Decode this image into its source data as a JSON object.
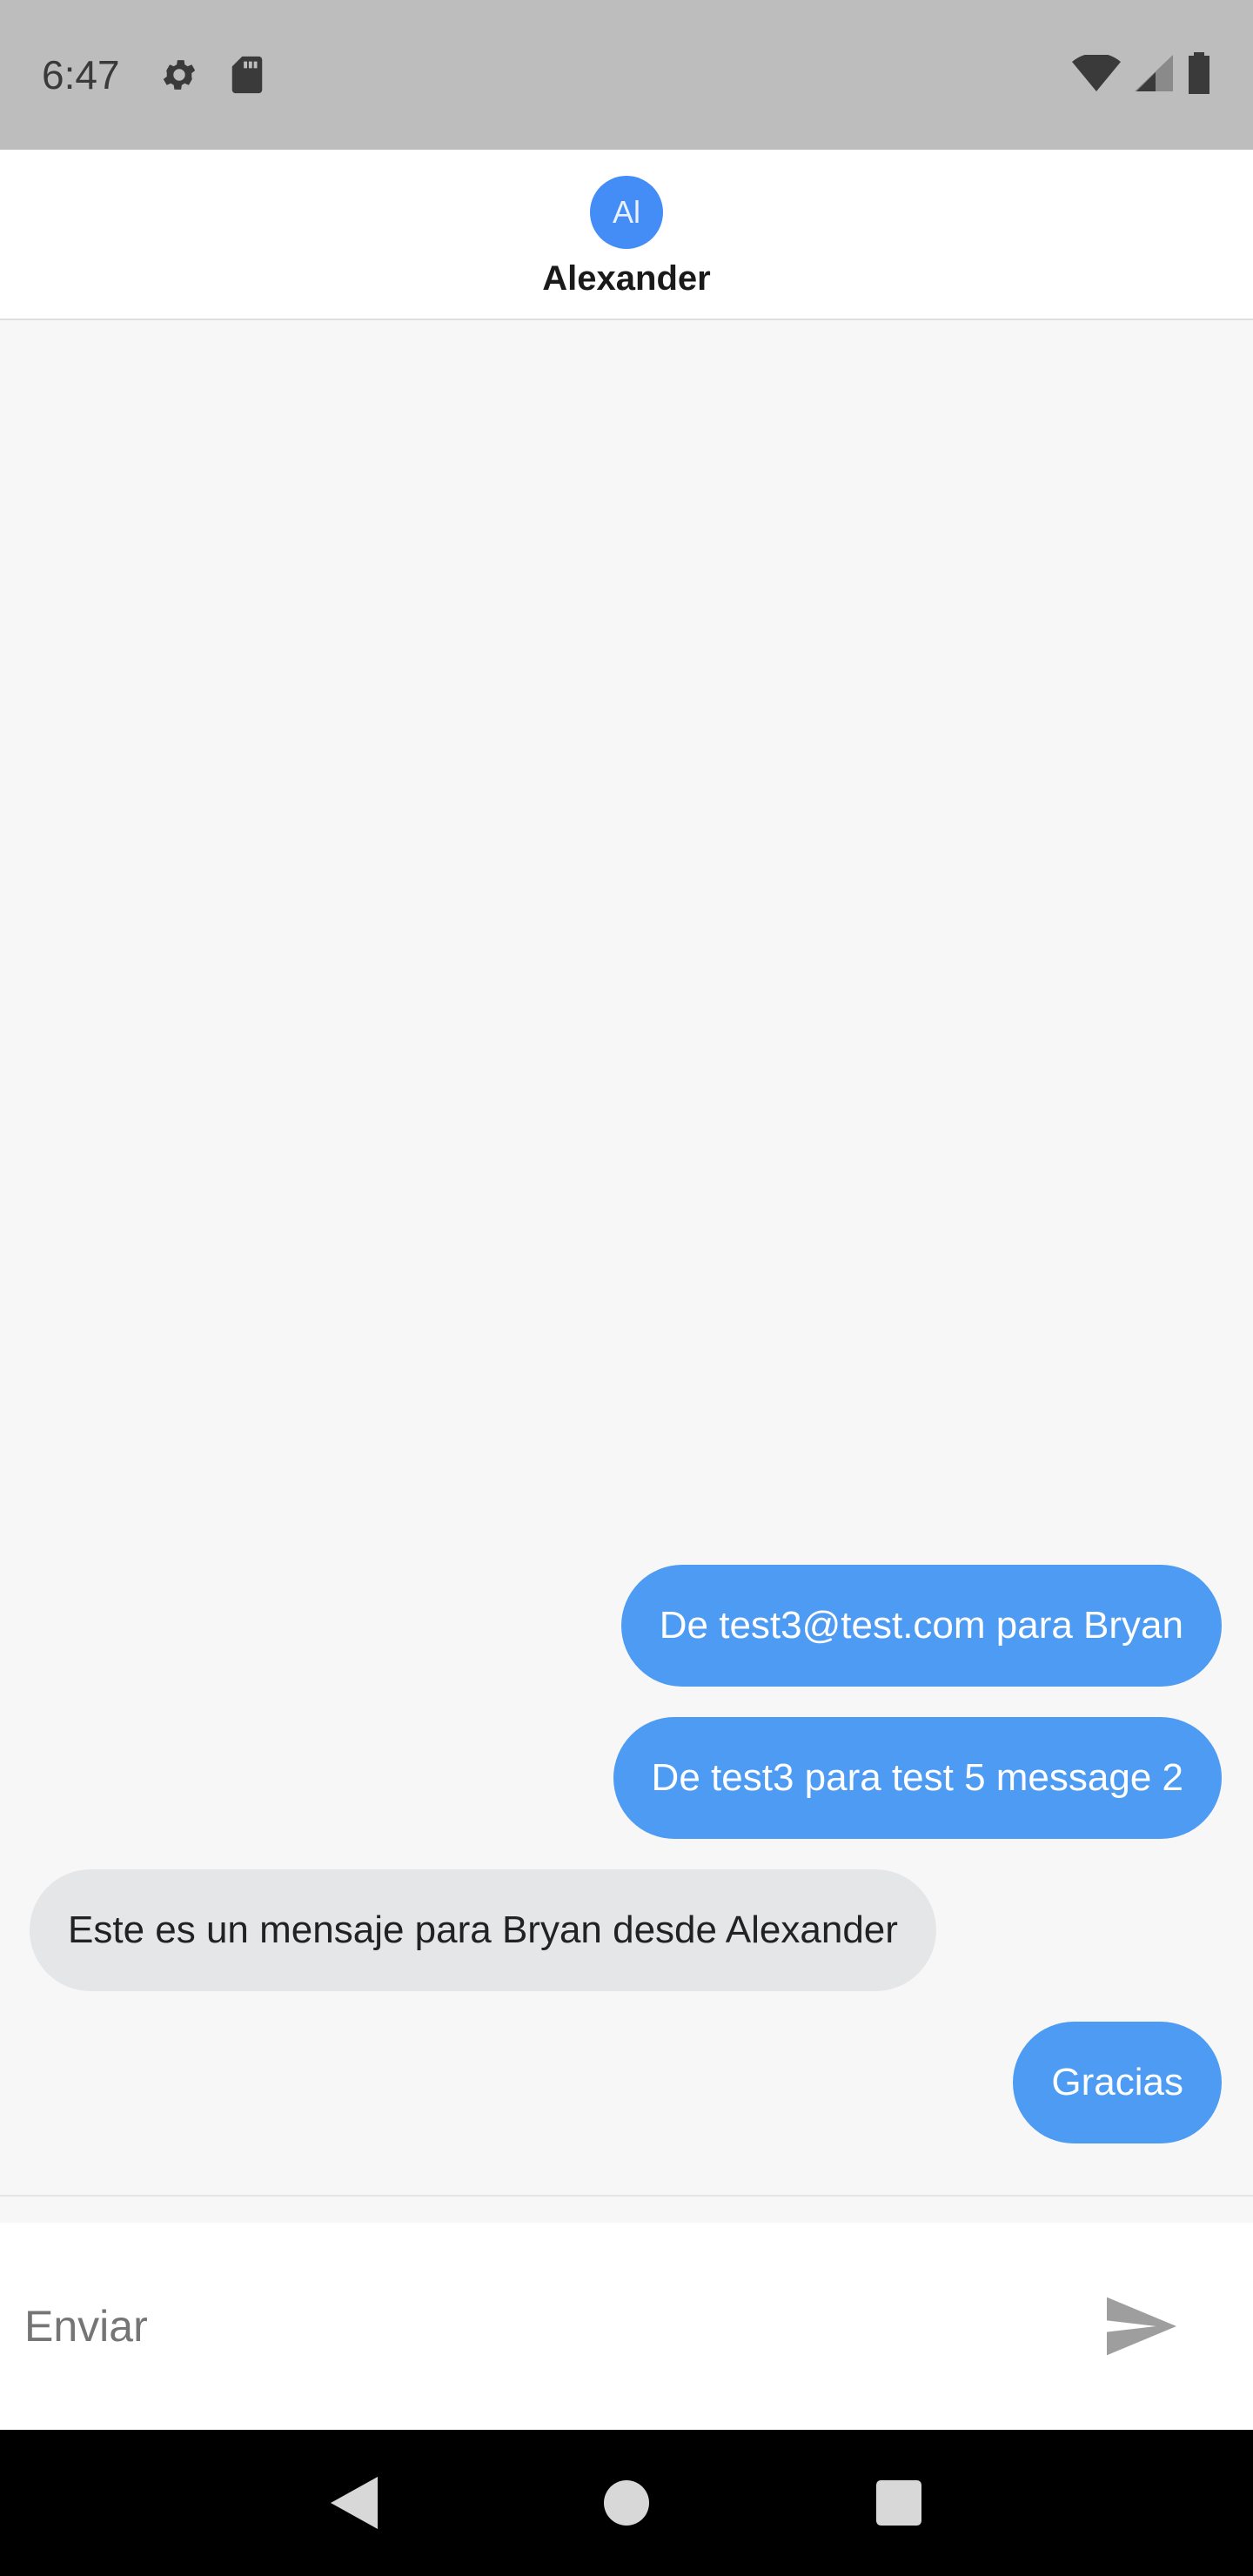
{
  "status_bar": {
    "time": "6:47",
    "icons_left": [
      "gear-icon",
      "sd-card-icon"
    ],
    "icons_right": [
      "wifi-icon",
      "signal-icon",
      "battery-icon"
    ]
  },
  "header": {
    "avatar_initials": "Al",
    "contact_name": "Alexander",
    "avatar_color": "#448df6"
  },
  "messages": [
    {
      "direction": "sent",
      "text": "De test3@test.com para Bryan"
    },
    {
      "direction": "sent",
      "text": "De test3 para test 5 message 2"
    },
    {
      "direction": "received",
      "text": "Este es un mensaje para Bryan desde Alexander"
    },
    {
      "direction": "sent",
      "text": "Gracias"
    }
  ],
  "colors": {
    "sent_bubble": "#4d9bf3",
    "received_bubble": "#e5e6e8"
  },
  "input": {
    "placeholder": "Enviar",
    "value": "",
    "send_icon": "send-icon"
  },
  "nav_bar": {
    "buttons": [
      "back-icon",
      "home-icon",
      "recents-icon"
    ]
  }
}
